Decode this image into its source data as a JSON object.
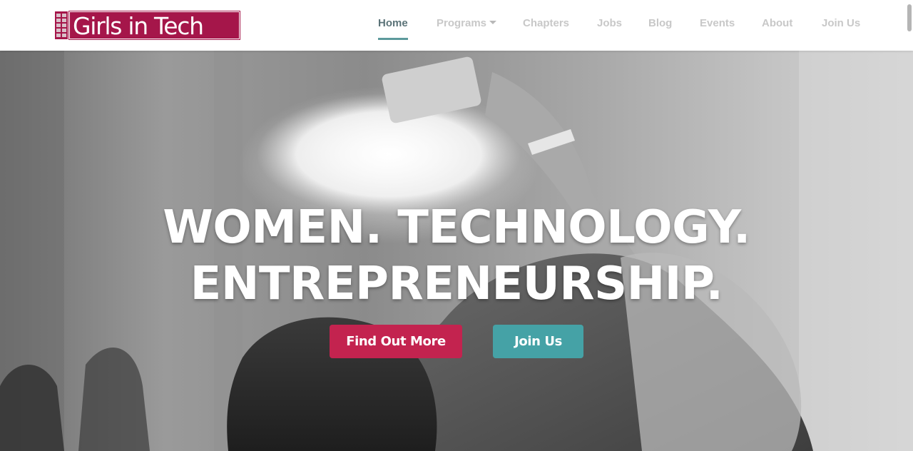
{
  "brand": {
    "logo_text": "Girls in Tech",
    "colors": {
      "logo": "#a5164a",
      "primary": "#c3234f",
      "secondary": "#45a2a6",
      "nav_active": "#5b7378",
      "nav_active_underline": "#5c9a9c"
    }
  },
  "nav": {
    "items": [
      {
        "label": "Home",
        "active": true
      },
      {
        "label": "Programs",
        "has_dropdown": true,
        "icon": "caret-down-icon"
      },
      {
        "label": "Chapters"
      },
      {
        "label": "Jobs"
      },
      {
        "label": "Blog"
      },
      {
        "label": "Events"
      },
      {
        "label": "About"
      },
      {
        "label": "Join Us"
      }
    ]
  },
  "hero": {
    "title_line1": "WOMEN. TECHNOLOGY.",
    "title_line2": "ENTREPRENEURSHIP.",
    "primary_button": "Find Out More",
    "secondary_button": "Join Us"
  }
}
